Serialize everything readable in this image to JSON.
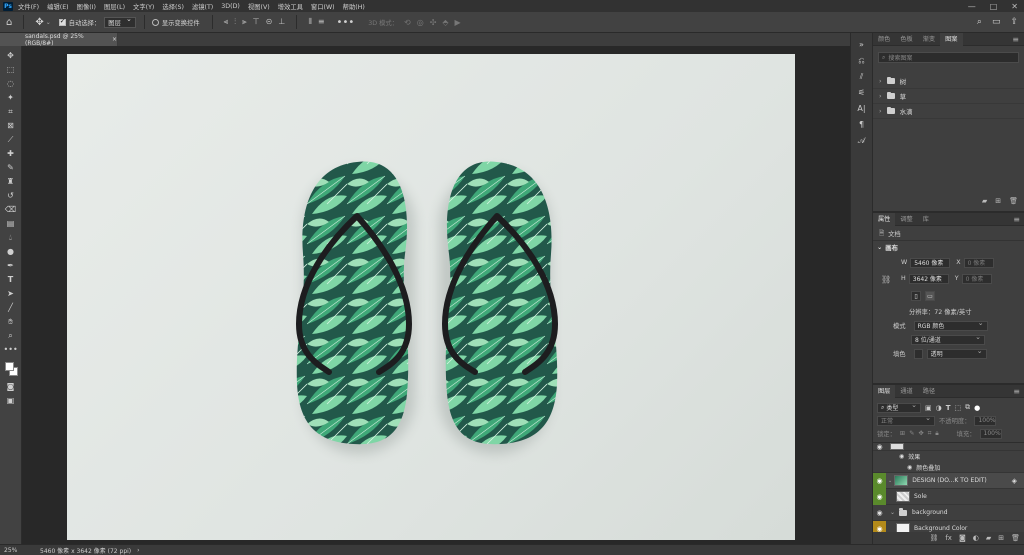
{
  "app": {
    "logo": "Ps"
  },
  "menu": [
    "文件(F)",
    "编辑(E)",
    "图像(I)",
    "图层(L)",
    "文字(Y)",
    "选择(S)",
    "滤镜(T)",
    "3D(D)",
    "视图(V)",
    "增效工具",
    "窗口(W)",
    "帮助(H)"
  ],
  "window_controls": {
    "minimize": "—",
    "maximize": "□",
    "close": "✕"
  },
  "options": {
    "auto_select_label": "自动选择：",
    "auto_select_target": "图层",
    "show_transform_label": "显示变换控件",
    "mode_3d_label": "3D 模式："
  },
  "document": {
    "tab_title": "sandals.psd @ 25%(RGB/8#)",
    "close": "×"
  },
  "status": {
    "zoom": "25%",
    "info": "5460 像素 x 3642 像素 (72 ppi)",
    "arrow": "›"
  },
  "top_panel": {
    "tabs": [
      "颜色",
      "色板",
      "渐变",
      "图案"
    ],
    "active_tab": 3,
    "search_placeholder": "搜索图案",
    "folders": [
      "树",
      "草",
      "水滴"
    ]
  },
  "properties_panel": {
    "tabs": [
      "属性",
      "调整",
      "库"
    ],
    "active_tab": 0,
    "doc_label": "文档",
    "section": "画布",
    "w_label": "W",
    "w_value": "5460 像素",
    "x_label": "X",
    "x_value": "0 像素",
    "h_label": "H",
    "h_value": "3642 像素",
    "y_label": "Y",
    "y_value": "0 像素",
    "resolution": "分辨率：72 像素/英寸",
    "mode_label": "模式",
    "mode_value": "RGB 颜色",
    "depth_value": "8 位/通道",
    "fill_label": "填色",
    "fill_value": "透明"
  },
  "layers_panel": {
    "tabs": [
      "图层",
      "通道",
      "路径"
    ],
    "active_tab": 0,
    "filter_kind": "类型",
    "blend_mode": "正常",
    "opacity_label": "不透明度：",
    "opacity_value": "100%",
    "lock_label": "锁定：",
    "fill_label": "填充：",
    "fill_value": "100%",
    "layers": [
      {
        "name": "",
        "type": "partial"
      },
      {
        "name": "效果",
        "type": "effect"
      },
      {
        "name": "颜色叠加",
        "type": "effect"
      },
      {
        "name": "DESIGN (DO...K TO EDIT)",
        "type": "smart"
      },
      {
        "name": "Sole",
        "type": "layer"
      },
      {
        "name": "background",
        "type": "group"
      },
      {
        "name": "Background Color",
        "type": "layer"
      }
    ]
  },
  "colors": {
    "menubar": "#323232",
    "panel": "#3f3f3f",
    "canvas_bg": "#e4e8e5",
    "leaf_dark": "#1f6e4d",
    "leaf_light": "#5fc48f",
    "strap": "#1d1d1f",
    "eye_green": "#5a8a2c",
    "eye_yellow": "#b38a1a"
  }
}
